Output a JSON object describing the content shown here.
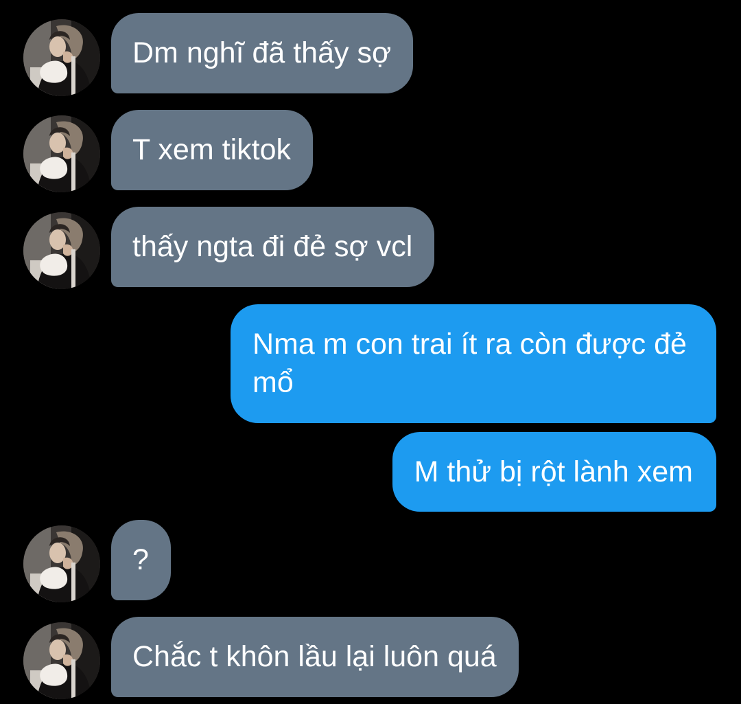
{
  "colors": {
    "background": "#000000",
    "incoming_bubble": "#647586",
    "outgoing_bubble": "#1d9bf0",
    "text": "#ffffff"
  },
  "contact": {
    "avatar_icon": "profile-photo-avatar"
  },
  "messages": [
    {
      "direction": "in",
      "text": "Dm nghĩ đã thấy sợ"
    },
    {
      "direction": "in",
      "text": "T xem tiktok"
    },
    {
      "direction": "in",
      "text": "thấy ngta đi đẻ sợ vcl"
    },
    {
      "direction": "out",
      "text": "Nma m con trai ít ra còn được đẻ mổ"
    },
    {
      "direction": "out",
      "text": "M thử bị rột lành xem"
    },
    {
      "direction": "in",
      "text": "?"
    },
    {
      "direction": "in",
      "text": "Chắc t khôn lầu lại luôn quá"
    }
  ]
}
